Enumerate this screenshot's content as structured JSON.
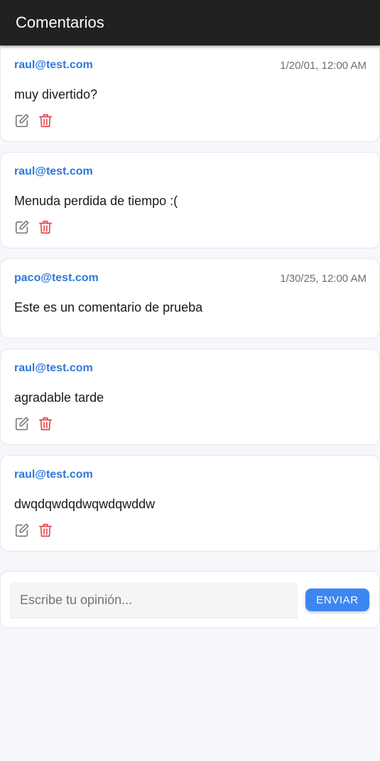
{
  "appbar": {
    "title": "Comentarios"
  },
  "comments": [
    {
      "author": "raul@test.com",
      "date": "1/20/01, 12:00 AM",
      "text": "muy divertido?",
      "editable": true
    },
    {
      "author": "raul@test.com",
      "date": "",
      "text": "Menuda perdida de tiempo :(",
      "editable": true
    },
    {
      "author": "paco@test.com",
      "date": "1/30/25, 12:00 AM",
      "text": "Este es un comentario de prueba",
      "editable": false
    },
    {
      "author": "raul@test.com",
      "date": "",
      "text": "agradable tarde",
      "editable": true
    },
    {
      "author": "raul@test.com",
      "date": "",
      "text": "dwqdqwdqdwqwdqwddw",
      "editable": true
    }
  ],
  "composer": {
    "placeholder": "Escribe tu opinión...",
    "value": "",
    "send_label": "ENVIAR"
  },
  "icons": {
    "edit": "edit-icon",
    "delete": "trash-icon"
  },
  "colors": {
    "appbar": "#212121",
    "author": "#2f78d8",
    "delete": "#e5484d",
    "edit": "#757575",
    "send_button": "#3d86f2",
    "background": "#f6f7fb"
  }
}
